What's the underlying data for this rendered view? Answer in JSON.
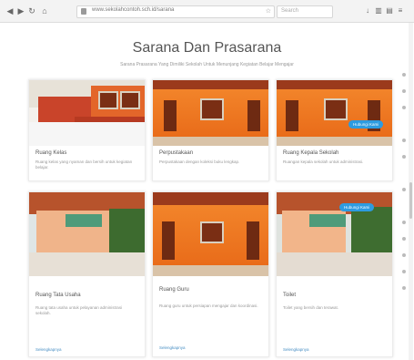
{
  "browser": {
    "url": "www.sekolahcontoh.sch.id/sarana",
    "search_placeholder": "Search"
  },
  "page": {
    "title": "Sarana Dan Prasarana",
    "subtitle": "Sarana Prasarana Yang Dimiliki Sekolah Untuk Menunjang Kegiatan Belajar Mengajar"
  },
  "cards": [
    {
      "title": "Ruang Kelas",
      "desc": "Ruang kelas yang nyaman dan bersih untuk kegiatan belajar.",
      "link": ""
    },
    {
      "title": "Perpustakaan",
      "desc": "Perpustakaan dengan koleksi buku lengkap.",
      "link": ""
    },
    {
      "title": "Ruang Kepala Sekolah",
      "desc": "Ruangan kepala sekolah untuk administrasi.",
      "link": ""
    },
    {
      "title": "Ruang Tata Usaha",
      "desc": "Ruang tata usaha untuk pelayanan administrasi sekolah.",
      "link": "Selengkapnya"
    },
    {
      "title": "Ruang Guru",
      "desc": "Ruang guru untuk persiapan mengajar dan koordinasi.",
      "link": "Selengkapnya"
    },
    {
      "title": "Toilet",
      "desc": "Toilet yang bersih dan terawat.",
      "link": "Selengkapnya"
    }
  ],
  "chips": [
    "Hubungi Kami",
    "Hubungi Kami"
  ],
  "colors": {
    "accent": "#2d9be0",
    "wall": "#f2842a",
    "roof": "#9b3a1c"
  }
}
